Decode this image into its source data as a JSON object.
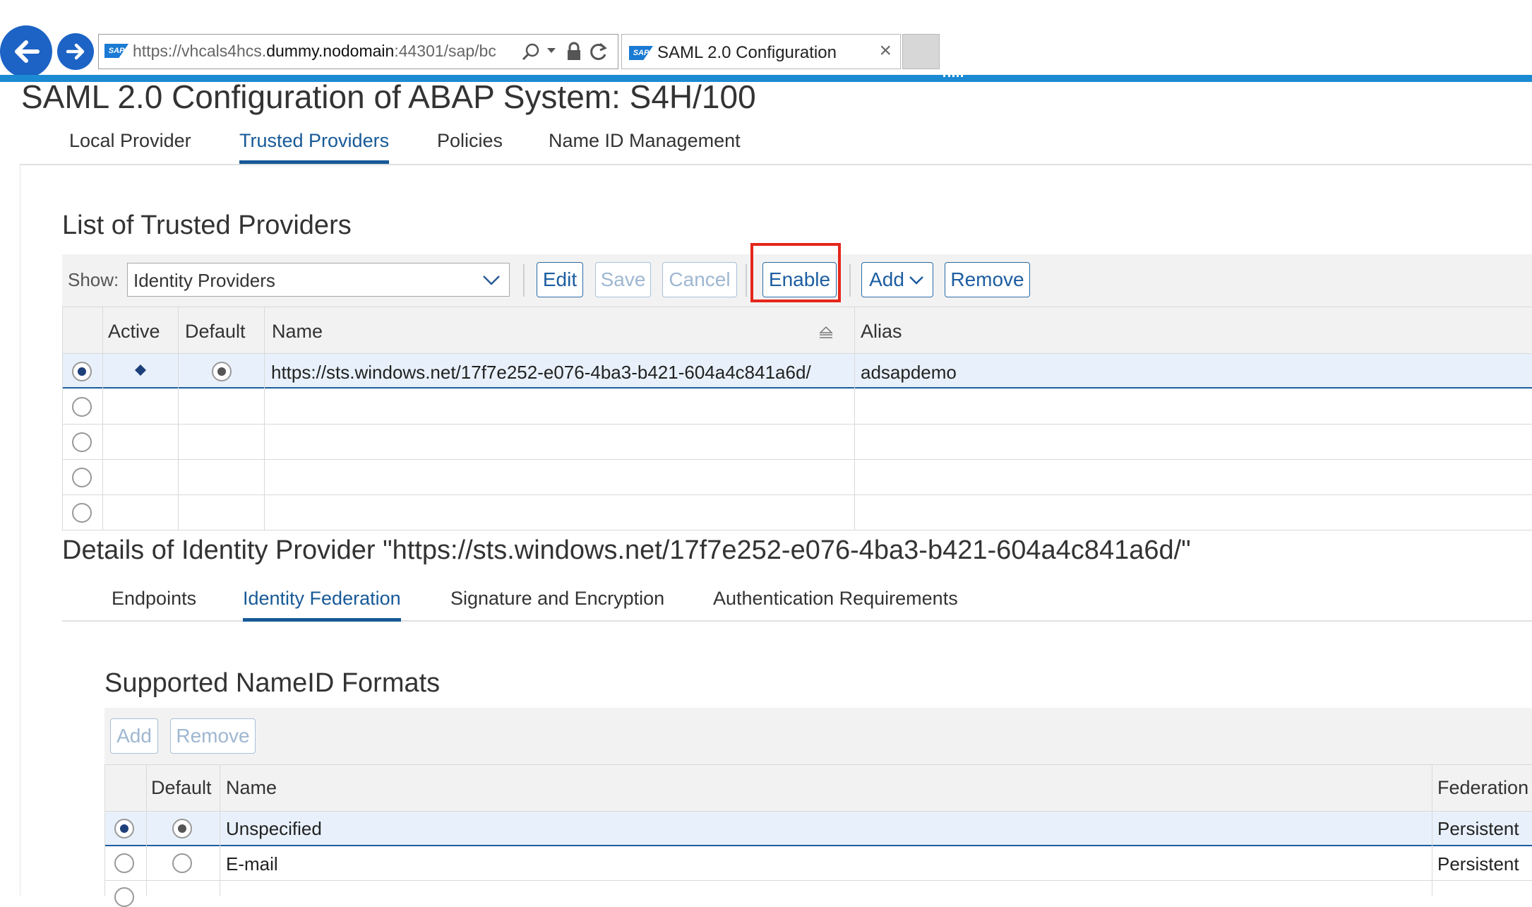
{
  "browser": {
    "address_url_prefix": "https://vhcals4hcs.",
    "address_url_host": "dummy.nodomain",
    "address_url_rest": ":44301/sap/bc",
    "tab_title": "SAML 2.0 Configuration",
    "accent": "#1b8ad3"
  },
  "page": {
    "title": "SAML 2.0 Configuration of ABAP System: S4H/100",
    "tabs": [
      {
        "label": "Local Provider"
      },
      {
        "label": "Trusted Providers"
      },
      {
        "label": "Policies"
      },
      {
        "label": "Name ID Management"
      }
    ]
  },
  "providers": {
    "heading": "List of Trusted Providers",
    "show_label": "Show:",
    "show_value": "Identity Providers",
    "buttons": {
      "edit": "Edit",
      "save": "Save",
      "cancel": "Cancel",
      "enable": "Enable",
      "add": "Add",
      "remove": "Remove"
    },
    "columns": [
      "Active",
      "Default",
      "Name",
      "Alias"
    ],
    "rows": [
      {
        "name": "https://sts.windows.net/17f7e252-e076-4ba3-b421-604a4c841a6d/",
        "alias": "adsapdemo"
      }
    ]
  },
  "details": {
    "heading": "Details of Identity Provider \"https://sts.windows.net/17f7e252-e076-4ba3-b421-604a4c841a6d/\"",
    "tabs": [
      {
        "label": "Endpoints"
      },
      {
        "label": "Identity Federation"
      },
      {
        "label": "Signature and Encryption"
      },
      {
        "label": "Authentication Requirements"
      }
    ],
    "nameid": {
      "heading": "Supported NameID Formats",
      "buttons": {
        "add": "Add",
        "remove": "Remove"
      },
      "columns": [
        "Default",
        "Name",
        "Federation"
      ],
      "rows": [
        {
          "name": "Unspecified",
          "federation": "Persistent"
        },
        {
          "name": "E-mail",
          "federation": "Persistent"
        }
      ]
    }
  }
}
